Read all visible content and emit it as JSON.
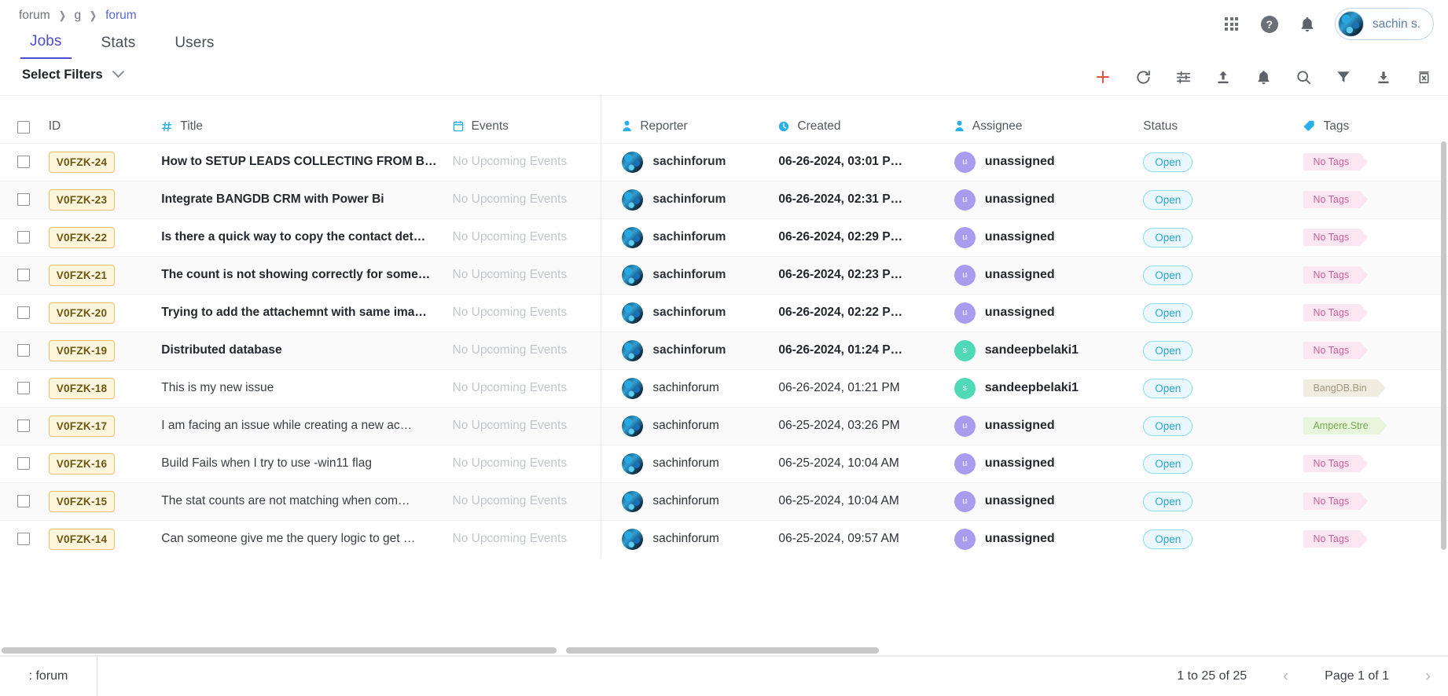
{
  "breadcrumb": {
    "items": [
      "forum",
      "g",
      "forum"
    ]
  },
  "tabs": [
    {
      "label": "Jobs",
      "active": true
    },
    {
      "label": "Stats",
      "active": false
    },
    {
      "label": "Users",
      "active": false
    }
  ],
  "topbar": {
    "apps_icon": "grid-apps-icon",
    "help_icon": "help-icon",
    "notifications_icon": "bell-icon",
    "user_name": "sachin s."
  },
  "filterbar": {
    "select_filters_label": "Select Filters",
    "chevron_icon": "chevron-down-icon",
    "tools": [
      {
        "name": "add-button",
        "icon": "plus-icon",
        "color": "#e8523f"
      },
      {
        "name": "refresh-button",
        "icon": "refresh-icon",
        "color": "#5d6268"
      },
      {
        "name": "tune-button",
        "icon": "tune-icon",
        "color": "#5d6268"
      },
      {
        "name": "upload-button",
        "icon": "upload-icon",
        "color": "#5d6268"
      },
      {
        "name": "alerts-button",
        "icon": "bell-icon",
        "color": "#5d6268"
      },
      {
        "name": "search-button",
        "icon": "search-icon",
        "color": "#5d6268"
      },
      {
        "name": "filter-button",
        "icon": "funnel-icon",
        "color": "#5d6268"
      },
      {
        "name": "download-button",
        "icon": "download-icon",
        "color": "#5d6268"
      },
      {
        "name": "delete-button",
        "icon": "trash-icon",
        "color": "#5d6268"
      }
    ]
  },
  "table": {
    "columns": [
      {
        "key": "checkbox",
        "label": "",
        "icon": "checkbox-icon"
      },
      {
        "key": "id",
        "label": "ID",
        "icon": ""
      },
      {
        "key": "title",
        "label": "Title",
        "icon": "hash-icon"
      },
      {
        "key": "events",
        "label": "Events",
        "icon": "calendar-icon"
      },
      {
        "key": "reporter",
        "label": "Reporter",
        "icon": "person-icon"
      },
      {
        "key": "created",
        "label": "Created",
        "icon": "clock-icon"
      },
      {
        "key": "assignee",
        "label": "Assignee",
        "icon": "person-icon"
      },
      {
        "key": "status",
        "label": "Status",
        "icon": ""
      },
      {
        "key": "tags",
        "label": "Tags",
        "icon": "tag-icon"
      }
    ],
    "rows": [
      {
        "id": "V0FZK-24",
        "title": "How to SETUP LEADS COLLECTING FROM B…",
        "unread": true,
        "events": "No Upcoming Events",
        "reporter": "sachinforum",
        "created": "06-26-2024, 03:01 P…",
        "assignee": "unassigned",
        "assignee_initial": "u",
        "assignee_kind": "u",
        "status": "Open",
        "tag": "No Tags",
        "tag_style": "pink"
      },
      {
        "id": "V0FZK-23",
        "title": "Integrate BANGDB CRM with Power Bi",
        "unread": true,
        "events": "No Upcoming Events",
        "reporter": "sachinforum",
        "created": "06-26-2024, 02:31 P…",
        "assignee": "unassigned",
        "assignee_initial": "u",
        "assignee_kind": "u",
        "status": "Open",
        "tag": "No Tags",
        "tag_style": "pink"
      },
      {
        "id": "V0FZK-22",
        "title": "Is there a quick way to copy the contact det…",
        "unread": true,
        "events": "No Upcoming Events",
        "reporter": "sachinforum",
        "created": "06-26-2024, 02:29 P…",
        "assignee": "unassigned",
        "assignee_initial": "u",
        "assignee_kind": "u",
        "status": "Open",
        "tag": "No Tags",
        "tag_style": "pink"
      },
      {
        "id": "V0FZK-21",
        "title": "The count is not showing correctly for some…",
        "unread": true,
        "events": "No Upcoming Events",
        "reporter": "sachinforum",
        "created": "06-26-2024, 02:23 P…",
        "assignee": "unassigned",
        "assignee_initial": "u",
        "assignee_kind": "u",
        "status": "Open",
        "tag": "No Tags",
        "tag_style": "pink"
      },
      {
        "id": "V0FZK-20",
        "title": "Trying to add the attachemnt with same ima…",
        "unread": true,
        "events": "No Upcoming Events",
        "reporter": "sachinforum",
        "created": "06-26-2024, 02:22 P…",
        "assignee": "unassigned",
        "assignee_initial": "u",
        "assignee_kind": "u",
        "status": "Open",
        "tag": "No Tags",
        "tag_style": "pink"
      },
      {
        "id": "V0FZK-19",
        "title": "Distributed database",
        "unread": true,
        "events": "No Upcoming Events",
        "reporter": "sachinforum",
        "created": "06-26-2024, 01:24 P…",
        "assignee": "sandeepbelaki1",
        "assignee_initial": "s",
        "assignee_kind": "s",
        "status": "Open",
        "tag": "No Tags",
        "tag_style": "pink"
      },
      {
        "id": "V0FZK-18",
        "title": "This is my new issue",
        "unread": false,
        "events": "No Upcoming Events",
        "reporter": "sachinforum",
        "created": "06-26-2024, 01:21 PM",
        "assignee": "sandeepbelaki1",
        "assignee_initial": "s",
        "assignee_kind": "s",
        "status": "Open",
        "tag": "BangDB.Bin",
        "tag_style": "beige"
      },
      {
        "id": "V0FZK-17",
        "title": "I am facing an issue while creating a new ac…",
        "unread": false,
        "events": "No Upcoming Events",
        "reporter": "sachinforum",
        "created": "06-25-2024, 03:26 PM",
        "assignee": "unassigned",
        "assignee_initial": "u",
        "assignee_kind": "u",
        "status": "Open",
        "tag": "Ampere.Stre",
        "tag_style": "green"
      },
      {
        "id": "V0FZK-16",
        "title": "Build Fails when I try to use -win11 flag",
        "unread": false,
        "events": "No Upcoming Events",
        "reporter": "sachinforum",
        "created": "06-25-2024, 10:04 AM",
        "assignee": "unassigned",
        "assignee_initial": "u",
        "assignee_kind": "u",
        "status": "Open",
        "tag": "No Tags",
        "tag_style": "pink"
      },
      {
        "id": "V0FZK-15",
        "title": "The stat counts are not matching when com…",
        "unread": false,
        "events": "No Upcoming Events",
        "reporter": "sachinforum",
        "created": "06-25-2024, 10:04 AM",
        "assignee": "unassigned",
        "assignee_initial": "u",
        "assignee_kind": "u",
        "status": "Open",
        "tag": "No Tags",
        "tag_style": "pink"
      },
      {
        "id": "V0FZK-14",
        "title": "Can someone give me the query logic to get …",
        "unread": false,
        "events": "No Upcoming Events",
        "reporter": "sachinforum",
        "created": "06-25-2024, 09:57 AM",
        "assignee": "unassigned",
        "assignee_initial": "u",
        "assignee_kind": "u",
        "status": "Open",
        "tag": "No Tags",
        "tag_style": "pink"
      }
    ]
  },
  "footer": {
    "context_label": ": forum",
    "range_label": "1 to 25 of 25",
    "prev_icon": "chevron-left-icon",
    "page_label": "Page 1 of 1",
    "next_icon": "chevron-right-icon"
  },
  "colors": {
    "accent": "#4b4fce",
    "header_icon": "#29b0e8",
    "id_badge_bg": "#fdf6dd",
    "id_badge_border": "#e0c56a",
    "status_open": "#2aa8d6",
    "add_button": "#e8523f"
  }
}
